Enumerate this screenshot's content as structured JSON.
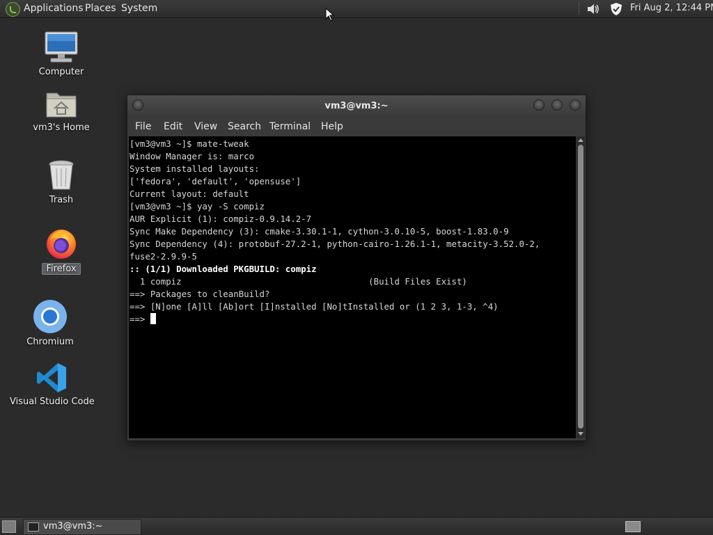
{
  "top_panel": {
    "menus": [
      "Applications",
      "Places",
      "System"
    ],
    "tray_icons": [
      "volume-icon",
      "security-shield-icon"
    ],
    "clock": "Fri Aug  2, 12:44 PM"
  },
  "desktop_icons": [
    {
      "label": "Computer",
      "icon": "computer-icon"
    },
    {
      "label": "vm3's Home",
      "icon": "home-folder-icon"
    },
    {
      "label": "Trash",
      "icon": "trash-icon"
    },
    {
      "label": "Firefox",
      "icon": "firefox-icon"
    },
    {
      "label": "Chromium",
      "icon": "chromium-icon"
    },
    {
      "label": "Visual Studio Code",
      "icon": "vscode-icon"
    }
  ],
  "terminal": {
    "title": "vm3@vm3:~",
    "menu": [
      "File",
      "Edit",
      "View",
      "Search",
      "Terminal",
      "Help"
    ],
    "lines": [
      "[vm3@vm3 ~]$ mate-tweak",
      "Window Manager is: marco",
      "System installed layouts:",
      "['fedora', 'default', 'opensuse']",
      "Current layout: default",
      "[vm3@vm3 ~]$ yay -S compiz",
      "AUR Explicit (1): compiz-0.9.14.2-7",
      "Sync Make Dependency (3): cmake-3.30.1-1, cython-3.0.10-5, boost-1.83.0-9",
      "Sync Dependency (4): protobuf-27.2-1, python-cairo-1.26.1-1, metacity-3.52.0-2,",
      "fuse2-2.9.9-5",
      ":: (1/1) Downloaded PKGBUILD: compiz",
      "  1 compiz                                    (Build Files Exist)",
      "==> Packages to cleanBuild?",
      "==> [N]one [A]ll [Ab]ort [I]nstalled [No]tInstalled or (1 2 3, 1-3, ^4)",
      "==> "
    ]
  },
  "taskbar": {
    "window_button": "vm3@vm3:~"
  }
}
